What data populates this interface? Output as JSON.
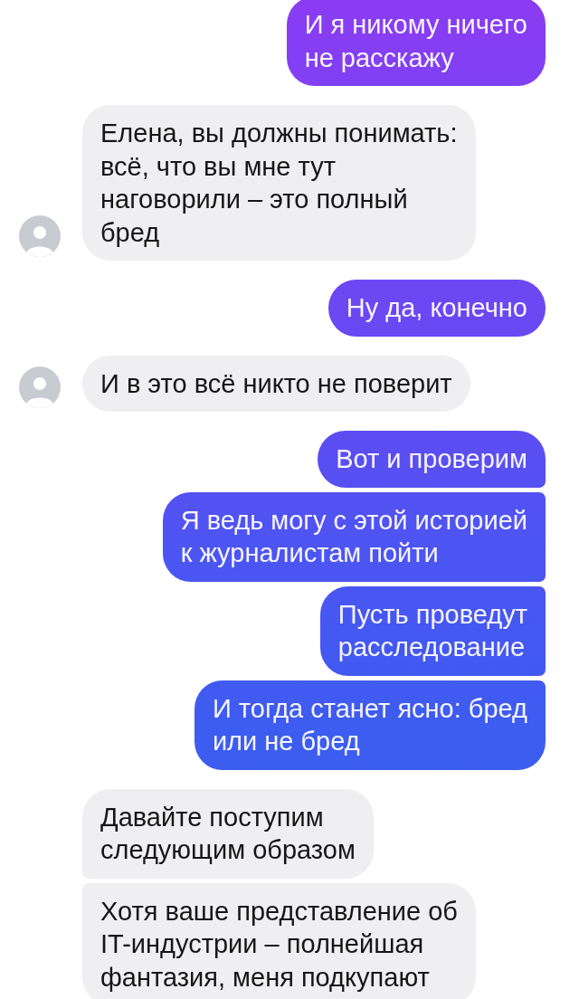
{
  "messages": [
    {
      "kind": "outgoing",
      "text": "И я никому ничего\nне расскажу"
    },
    {
      "kind": "incoming",
      "text": "Елена, вы должны понимать:\nвсё, что вы мне тут\nнаговорили – это полный\nбред",
      "avatar": true
    },
    {
      "kind": "outgoing",
      "text": "Ну да, конечно"
    },
    {
      "kind": "incoming",
      "text": "И в это всё никто не поверит",
      "avatar": true
    },
    {
      "kind": "outgoing",
      "text": "Вот и проверим"
    },
    {
      "kind": "outgoing",
      "text": "Я ведь могу с этой историей\nк журналистам пойти"
    },
    {
      "kind": "outgoing",
      "text": "Пусть проведут\nрасследование"
    },
    {
      "kind": "outgoing",
      "text": "И тогда станет ясно: бред\nили не бред"
    },
    {
      "kind": "incoming",
      "text": "Давайте поступим\nследующим образом",
      "avatar": false
    },
    {
      "kind": "incoming",
      "text": "Хотя ваше представление об\nIT-индустрии – полнейшая\nфантазия, меня подкупают",
      "avatar": false
    }
  ]
}
